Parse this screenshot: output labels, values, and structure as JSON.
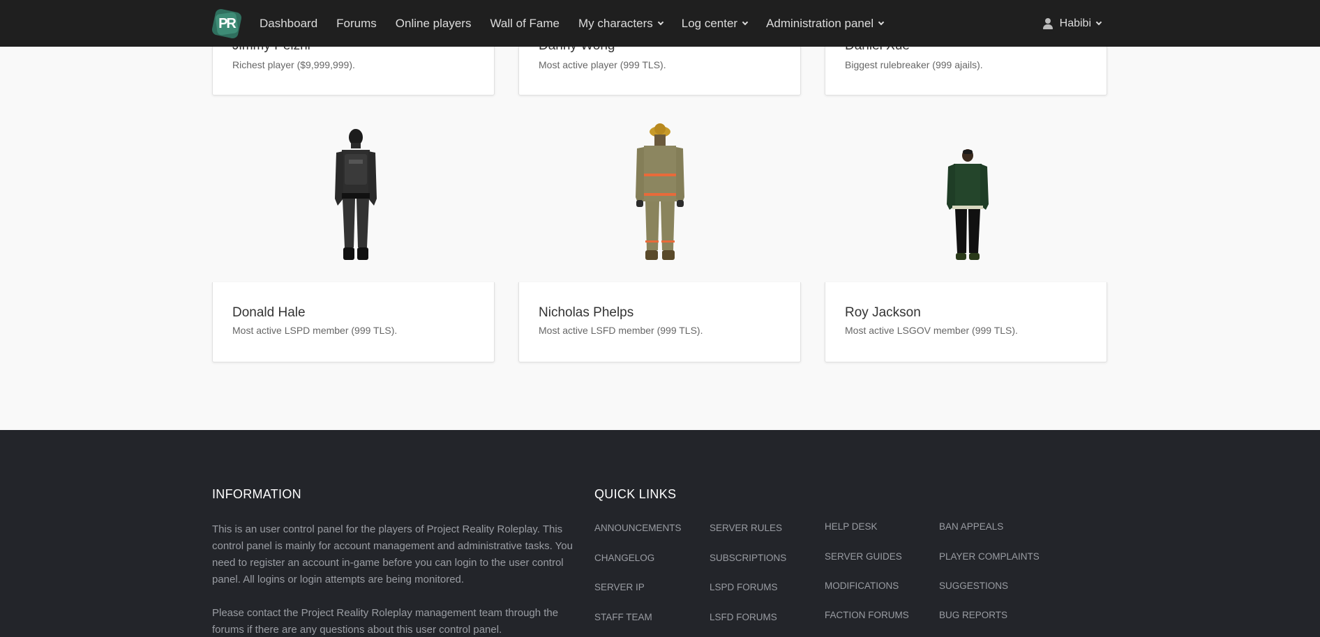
{
  "nav": {
    "logo_text": "PR",
    "links": [
      {
        "label": "Dashboard"
      },
      {
        "label": "Forums"
      },
      {
        "label": "Online players"
      },
      {
        "label": "Wall of Fame"
      },
      {
        "label": "My characters"
      },
      {
        "label": "Log center"
      },
      {
        "label": "Administration panel"
      }
    ],
    "user": "Habibi"
  },
  "top_cards": [
    {
      "name": "Jimmy Pelzni",
      "desc": "Richest player ($9,999,999)."
    },
    {
      "name": "Danny Wong",
      "desc": "Most active player (999 TLS)."
    },
    {
      "name": "Daniel Xue",
      "desc": "Biggest rulebreaker (999 ajails)."
    }
  ],
  "bottom_cards": [
    {
      "name": "Donald Hale",
      "desc": "Most active LSPD member (999 TLS).",
      "figure": "police-officer-icon"
    },
    {
      "name": "Nicholas Phelps",
      "desc": "Most active LSFD member (999 TLS).",
      "figure": "firefighter-icon"
    },
    {
      "name": "Roy Jackson",
      "desc": "Most active LSGOV member (999 TLS).",
      "figure": "civilian-icon"
    }
  ],
  "footer": {
    "info_heading": "INFORMATION",
    "info_p1": "This is an user control panel for the players of Project Reality Roleplay. This control panel is mainly for account management and administrative tasks. You need to register an account in-game before you can login to the user control panel. All logins or login attempts are being monitored.",
    "info_p2": "Please contact the Project Reality Roleplay management team through the forums if there are any questions about this user control panel.",
    "links_heading": "QUICK LINKS",
    "links": [
      [
        "ANNOUNCEMENTS",
        "CHANGELOG",
        "SERVER IP",
        "STAFF TEAM"
      ],
      [
        "SERVER RULES",
        "SUBSCRIPTIONS",
        "LSPD FORUMS",
        "LSFD FORUMS"
      ],
      [
        "HELP DESK",
        "SERVER GUIDES",
        "MODIFICATIONS",
        "FACTION FORUMS"
      ],
      [
        "BAN APPEALS",
        "PLAYER COMPLAINTS",
        "SUGGESTIONS",
        "BUG REPORTS"
      ]
    ]
  },
  "colors": {
    "navbar_bg": "#1f1f1f",
    "footer_bg": "#23252a",
    "page_bg": "#f9f9f9",
    "logo_accent": "#3e8c76"
  }
}
